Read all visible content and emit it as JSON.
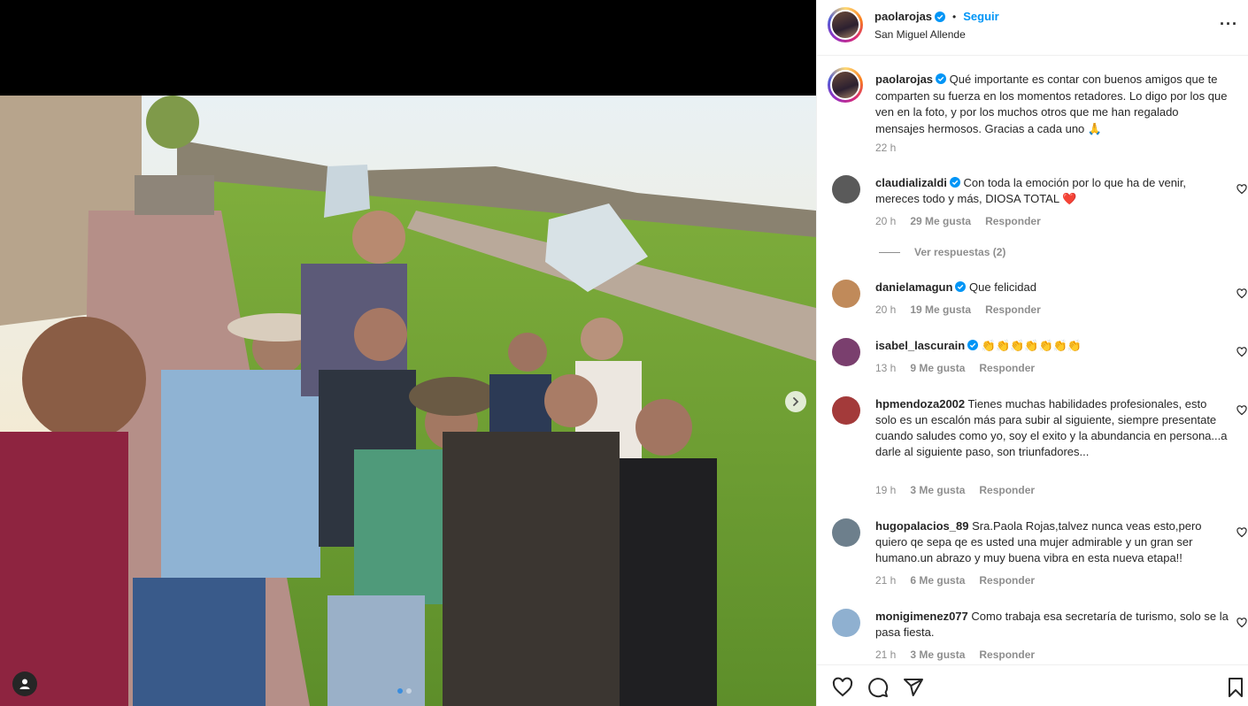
{
  "post": {
    "author": "paolarojas",
    "follow_label": "Seguir",
    "separator": "•",
    "location": "San Miguel Allende",
    "more_label": "···",
    "caption": "Qué importante es contar con buenos amigos que te comparten su fuerza en los momentos retadores. Lo digo por los que ven en la foto, y por los muchos otros que me han regalado mensajes hermosos. Gracias a cada uno 🙏",
    "caption_time": "22 h"
  },
  "comments": [
    {
      "user": "claudializaldi",
      "verified": true,
      "text": "Con toda la emoción por lo que ha de venir, mereces todo y más, DIOSA TOTAL ❤️",
      "time": "20 h",
      "likes": "29 Me gusta",
      "reply": "Responder",
      "avatar_color": "#5a5a5a"
    },
    {
      "user": "danielamagun",
      "verified": true,
      "text": "Que felicidad",
      "time": "20 h",
      "likes": "19 Me gusta",
      "reply": "Responder",
      "avatar_color": "#c08a5a"
    },
    {
      "user": "isabel_lascurain",
      "verified": true,
      "text": "👏👏👏👏👏👏👏",
      "time": "13 h",
      "likes": "9 Me gusta",
      "reply": "Responder",
      "avatar_color": "#7a3f6e"
    },
    {
      "user": "hpmendoza2002",
      "verified": false,
      "text": "Tienes muchas habilidades profesionales, esto solo es un escalón más para subir al siguiente, siempre presentate cuando saludes como yo, soy el exito y la abundancia en persona...a darle al siguiente paso, son triunfadores...",
      "time": "19 h",
      "likes": "3 Me gusta",
      "reply": "Responder",
      "avatar_color": "#a33a3a"
    },
    {
      "user": "hugopalacios_89",
      "verified": false,
      "text": "Sra.Paola Rojas,talvez nunca veas esto,pero quiero qe sepa qe es usted una mujer admirable y un gran ser humano.un abrazo y muy buena vibra en esta nueva etapa!!",
      "time": "21 h",
      "likes": "6 Me gusta",
      "reply": "Responder",
      "avatar_color": "#6d7f8c"
    },
    {
      "user": "monigimenez077",
      "verified": false,
      "text": "Como trabaja esa secretaría de turismo, solo se la pasa fiesta.",
      "time": "21 h",
      "likes": "3 Me gusta",
      "reply": "Responder",
      "avatar_color": "#8fb0d0"
    }
  ],
  "view_replies": "Ver respuestas (2)"
}
